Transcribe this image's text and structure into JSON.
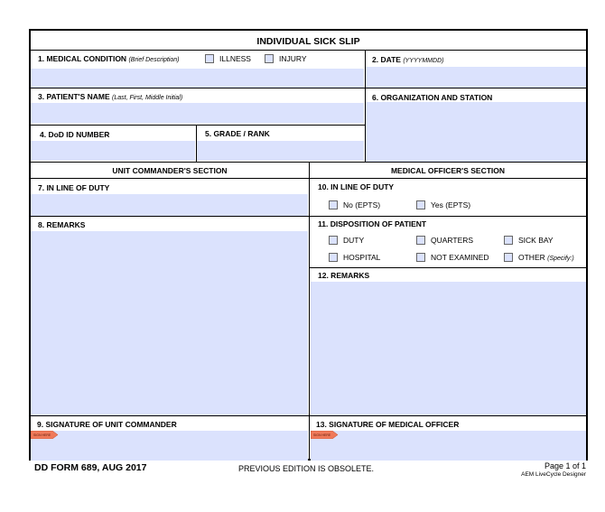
{
  "form": {
    "title": "INDIVIDUAL SICK SLIP",
    "block1": {
      "label": "1. MEDICAL CONDITION",
      "hint": "(Brief Description)",
      "illness": "ILLNESS",
      "injury": "INJURY"
    },
    "block2": {
      "label": "2. DATE",
      "hint": "(YYYYMMDD)"
    },
    "block3": {
      "label": "3. PATIENT'S NAME",
      "hint": "(Last, First, Middle Initial)"
    },
    "block4": {
      "label": "4. DoD ID NUMBER"
    },
    "block5": {
      "label": "5. GRADE / RANK"
    },
    "block6": {
      "label": "6. ORGANIZATION AND STATION"
    },
    "unit_section": "UNIT COMMANDER'S SECTION",
    "medical_section": "MEDICAL OFFICER'S SECTION",
    "block7": {
      "label": "7. IN LINE OF DUTY"
    },
    "block8": {
      "label": "8. REMARKS"
    },
    "block9": {
      "label": "9. SIGNATURE OF UNIT COMMANDER"
    },
    "block10": {
      "label": "10. IN LINE OF DUTY",
      "no": "No (EPTS)",
      "yes": "Yes (EPTS)"
    },
    "block11": {
      "label": "11. DISPOSITION OF PATIENT",
      "duty": "DUTY",
      "quarters": "QUARTERS",
      "sickbay": "SICK BAY",
      "hospital": "HOSPITAL",
      "not_examined": "NOT EXAMINED",
      "other": "OTHER",
      "other_hint": "(Specify:)"
    },
    "block12": {
      "label": "12. REMARKS"
    },
    "block13": {
      "label": "13. SIGNATURE OF MEDICAL OFFICER"
    },
    "sign_tag": "SIGN HERE"
  },
  "footer": {
    "form_id": "DD FORM 689, AUG 2017",
    "edition": "PREVIOUS EDITION IS OBSOLETE.",
    "page": "Page 1 of 1",
    "designer": "AEM LiveCycle Designer"
  },
  "colors": {
    "field": "#dbe2fd",
    "sign_tag": "#f07a5a"
  }
}
